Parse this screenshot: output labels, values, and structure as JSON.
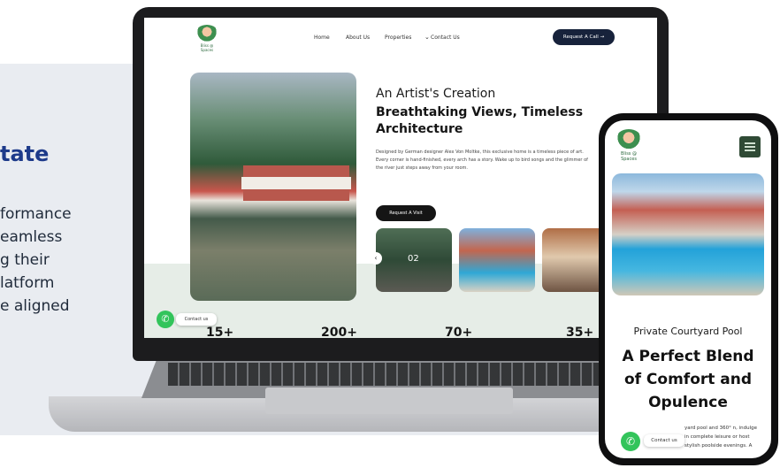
{
  "side": {
    "title": "tate",
    "lines": [
      "formance",
      "eamless",
      "g their",
      "latform",
      "e aligned"
    ]
  },
  "site": {
    "logo_text": "Bliss @ Spaces",
    "nav": [
      "Home",
      "About Us",
      "Properties",
      "Contact Us"
    ],
    "cta": "Request A Call →",
    "hero": {
      "pretitle": "An Artist's Creation",
      "title": "Breathtaking Views, Timeless Architecture",
      "description": "Designed by German designer Alex Von Moltke, this exclusive home is a timeless piece of art. Every corner is hand-finished, every arch has a story. Wake up to bird songs and the glimmer of the river just steps away from your room.",
      "button": "Request A Visit"
    },
    "thumb_label": "02",
    "stats": [
      "15+",
      "200+",
      "70+",
      "35+"
    ],
    "contact_label": "Contact us"
  },
  "phone": {
    "logo_text": "Bliss @ Spaces",
    "subtitle": "Private Courtyard Pool",
    "title": "A Perfect Blend of Comfort and Opulence",
    "description": "yard pool and 360° n, indulge in complete leisure or host stylish poolside evenings. A",
    "contact_label": "Contact us"
  },
  "colors": {
    "navy": "#17223b",
    "brand_blue": "#1d3a8a",
    "whatsapp": "#33c45b",
    "menu_green": "#2f4a35"
  }
}
